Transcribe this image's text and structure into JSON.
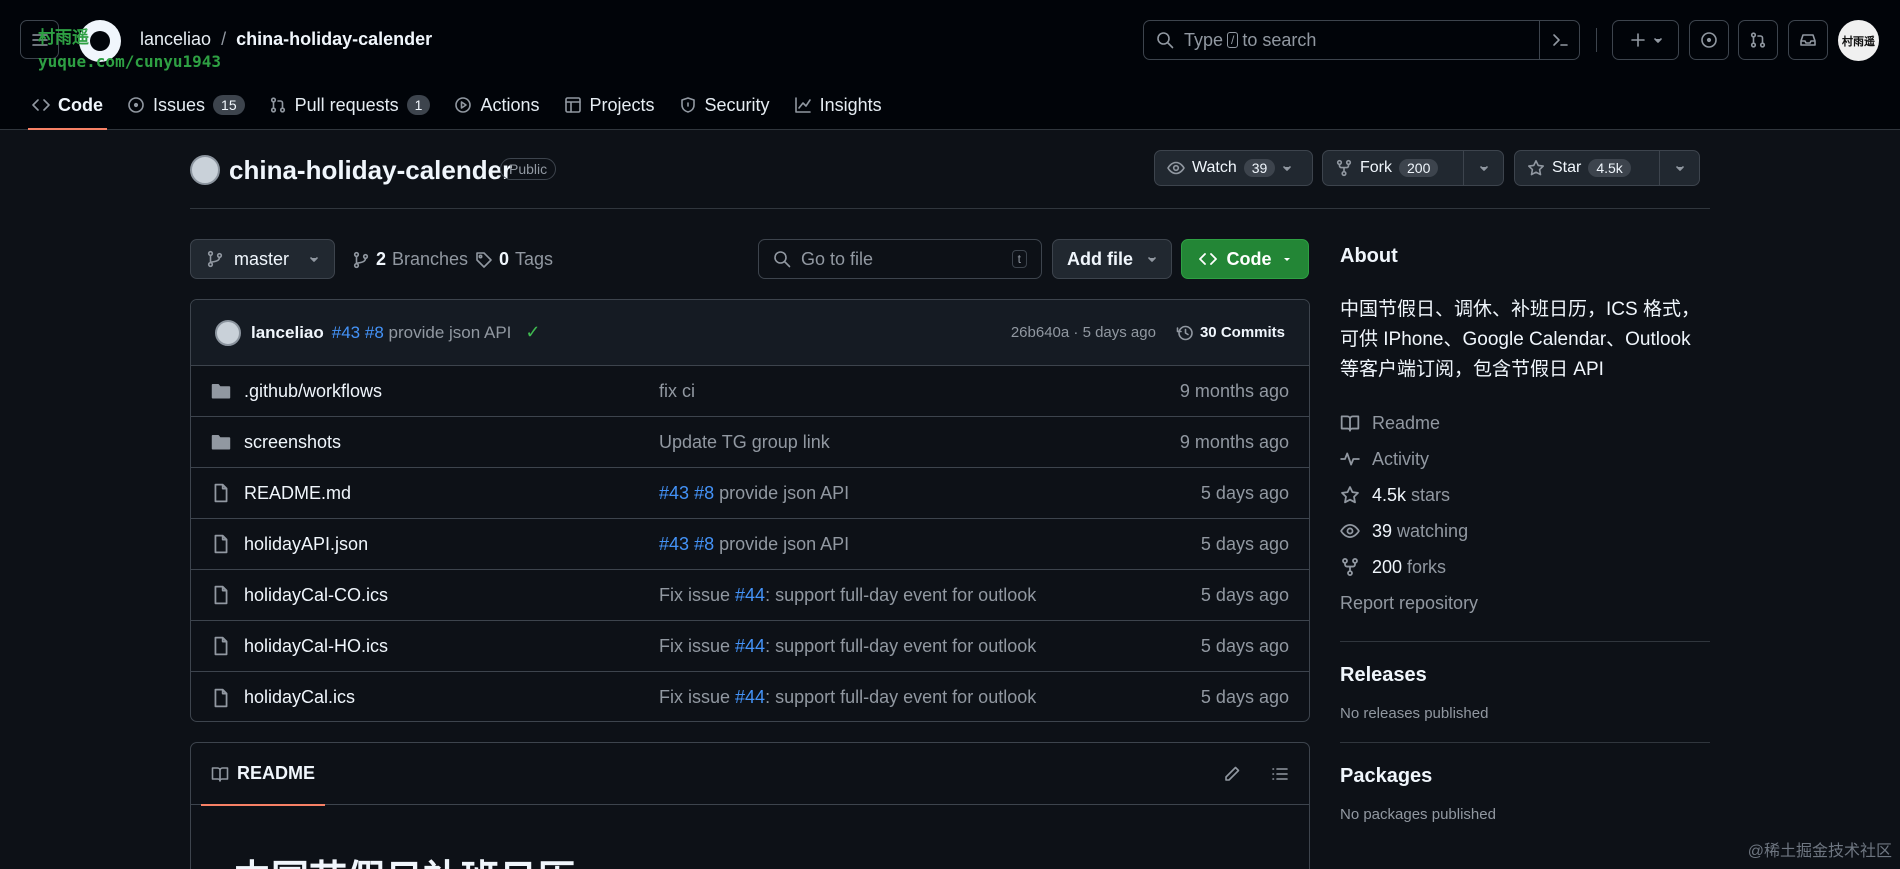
{
  "watermark": {
    "title": "村雨遥",
    "url": "yuque.com/cunyu1943"
  },
  "header": {
    "owner": "lanceliao",
    "separator": "/",
    "repo": "china-holiday-calender",
    "search": {
      "prefix": "Type",
      "key": "/",
      "suffix": "to search"
    },
    "user_avatar_text": "村雨遥"
  },
  "nav": [
    {
      "label": "Code",
      "icon": "code-icon",
      "selected": true
    },
    {
      "label": "Issues",
      "icon": "issue-icon",
      "count": "15"
    },
    {
      "label": "Pull requests",
      "icon": "pull-request-icon",
      "count": "1"
    },
    {
      "label": "Actions",
      "icon": "play-icon"
    },
    {
      "label": "Projects",
      "icon": "table-icon"
    },
    {
      "label": "Security",
      "icon": "shield-icon"
    },
    {
      "label": "Insights",
      "icon": "graph-icon"
    }
  ],
  "repo_header": {
    "title": "china-holiday-calender",
    "visibility": "Public",
    "watch": {
      "label": "Watch",
      "count": "39"
    },
    "fork": {
      "label": "Fork",
      "count": "200"
    },
    "star": {
      "label": "Star",
      "count": "4.5k"
    }
  },
  "toolbar": {
    "branch": "master",
    "branches": {
      "count": "2",
      "label": "Branches"
    },
    "tags": {
      "count": "0",
      "label": "Tags"
    },
    "goto_placeholder": "Go to file",
    "goto_key": "t",
    "add_file": "Add file",
    "code": "Code"
  },
  "latest_commit": {
    "author": "lanceliao",
    "refs": [
      "#43",
      "#8"
    ],
    "message": "provide json API",
    "status": "✓",
    "sha_time": "26b640a · 5 days ago",
    "commits_label": "30 Commits"
  },
  "files": [
    {
      "type": "folder",
      "name": ".github/workflows",
      "msg_pre": "fix ci",
      "refs": [],
      "msg_post": "",
      "date": "9 months ago"
    },
    {
      "type": "folder",
      "name": "screenshots",
      "msg_pre": "Update TG group link",
      "refs": [],
      "msg_post": "",
      "date": "9 months ago"
    },
    {
      "type": "file",
      "name": "README.md",
      "msg_pre": "",
      "refs": [
        "#43",
        "#8"
      ],
      "msg_post": " provide json API",
      "date": "5 days ago"
    },
    {
      "type": "file",
      "name": "holidayAPI.json",
      "msg_pre": "",
      "refs": [
        "#43",
        "#8"
      ],
      "msg_post": " provide json API",
      "date": "5 days ago"
    },
    {
      "type": "file",
      "name": "holidayCal-CO.ics",
      "msg_pre": "Fix issue ",
      "refs": [
        "#44"
      ],
      "msg_post": ": support full-day event for outlook",
      "date": "5 days ago"
    },
    {
      "type": "file",
      "name": "holidayCal-HO.ics",
      "msg_pre": "Fix issue ",
      "refs": [
        "#44"
      ],
      "msg_post": ": support full-day event for outlook",
      "date": "5 days ago"
    },
    {
      "type": "file",
      "name": "holidayCal.ics",
      "msg_pre": "Fix issue ",
      "refs": [
        "#44"
      ],
      "msg_post": ": support full-day event for outlook",
      "date": "5 days ago"
    }
  ],
  "readme": {
    "tab": "README",
    "heading": "中国节假日补班日历"
  },
  "sidebar": {
    "about_title": "About",
    "description": "中国节假日、调休、补班日历，ICS 格式，可供 IPhone、Google Calendar、Outlook 等客户端订阅，包含节假日 API",
    "links": [
      {
        "icon": "book-icon",
        "strong": "",
        "label": "Readme"
      },
      {
        "icon": "pulse-icon",
        "strong": "",
        "label": "Activity"
      },
      {
        "icon": "star-icon",
        "strong": "4.5k",
        "label": "stars"
      },
      {
        "icon": "eye-icon",
        "strong": "39",
        "label": "watching"
      },
      {
        "icon": "fork-icon",
        "strong": "200",
        "label": "forks"
      }
    ],
    "report": "Report repository",
    "releases_title": "Releases",
    "releases_text": "No releases published",
    "packages_title": "Packages",
    "packages_text": "No packages published"
  },
  "footer_mark": "@稀土掘金技术社区",
  "colors": {
    "accent_underline": "#f78166",
    "code_button": "#238636",
    "link": "#4493f8",
    "success": "#3fb950"
  }
}
